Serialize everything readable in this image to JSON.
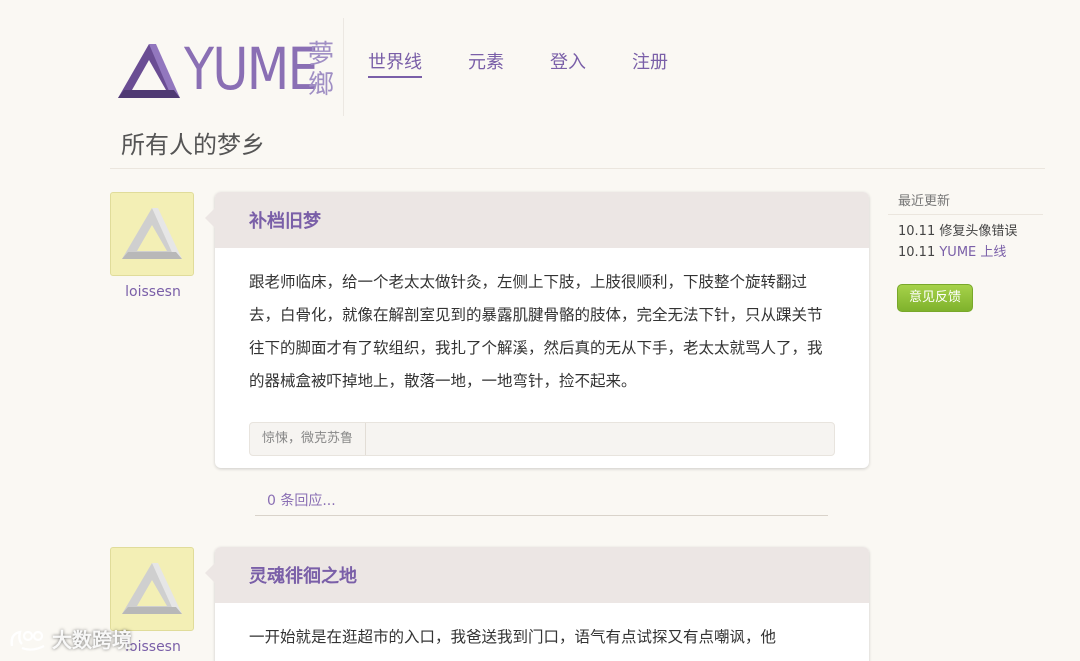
{
  "logo": {
    "word": "YUME",
    "cn_line1": "夢",
    "cn_line2": "鄉"
  },
  "nav": [
    {
      "label": "世界线",
      "active": true
    },
    {
      "label": "元素",
      "active": false
    },
    {
      "label": "登入",
      "active": false
    },
    {
      "label": "注册",
      "active": false
    }
  ],
  "page_title": "所有人的梦乡",
  "posts": [
    {
      "author": "loissesn",
      "title": "补档旧梦",
      "body": "跟老师临床，给一个老太太做针灸，左侧上下肢，上肢很顺利，下肢整个旋转翻过去，白骨化，就像在解剖室见到的暴露肌腱骨骼的肢体，完全无法下针，只从踝关节往下的脚面才有了软组织，我扎了个解溪，然后真的无从下手，老太太就骂人了，我的器械盒被吓掉地上，散落一地，一地弯针，捡不起来。",
      "tags": "惊悚，微克苏鲁",
      "replies": "0 条回应..."
    },
    {
      "author": "loissesn",
      "title": "灵魂徘徊之地",
      "body": "一开始就是在逛超市的入口，我爸送我到门口，语气有点试探又有点嘲讽，他"
    }
  ],
  "sidebar": {
    "title": "最近更新",
    "items": [
      {
        "date": "10.11",
        "text": "修复头像错误",
        "highlight": ""
      },
      {
        "date": "10.11",
        "text": "",
        "highlight": "YUME 上线"
      }
    ],
    "feedback_label": "意见反馈"
  },
  "watermark": "大数跨境",
  "colors": {
    "accent": "#7a5fa8",
    "background": "#faf8f3",
    "card_header": "#ece6e4",
    "avatar_bg": "#f3efb5",
    "feedback_green": "#8fc23a"
  }
}
